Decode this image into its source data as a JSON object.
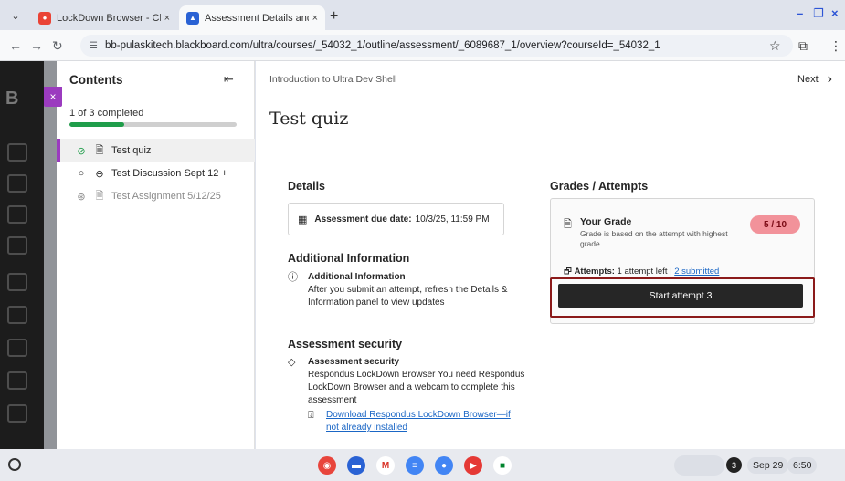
{
  "browser": {
    "tabs": [
      {
        "title": "LockDown Browser - Chrome W",
        "close": "×"
      },
      {
        "title": "Assessment Details and Inform",
        "close": "×"
      }
    ],
    "new_tab": "+",
    "url": "bb-pulaskitech.blackboard.com/ultra/courses/_54032_1/outline/assessment/_6089687_1/overview?courseId=_54032_1"
  },
  "contents_panel": {
    "title": "Contents",
    "progress_text": "1 of 3 completed",
    "progress_fraction": 0.33,
    "items": [
      {
        "label": "Test quiz"
      },
      {
        "label": "Test Discussion Sept 12 +"
      },
      {
        "label": "Test Assignment 5/12/25"
      }
    ]
  },
  "main": {
    "breadcrumb": "Introduction to Ultra Dev Shell",
    "next_label": "Next",
    "page_title": "Test quiz",
    "details": {
      "heading": "Details",
      "due_label": "Assessment due date:",
      "due_value": "10/3/25, 11:59 PM"
    },
    "additional_info": {
      "heading": "Additional Information",
      "title": "Additional Information",
      "body": "After you submit an attempt, refresh the Details & Information panel to view updates"
    },
    "security": {
      "heading": "Assessment security",
      "title": "Assessment security",
      "body": "Respondus LockDown Browser You need Respondus LockDown Browser and a webcam to complete this assessment",
      "download_link": "Download Respondus LockDown Browser—if not already installed"
    },
    "grades": {
      "heading": "Grades / Attempts",
      "your_grade_label": "Your Grade",
      "grade_note": "Grade is based on the attempt with highest grade.",
      "grade_value": "5 / 10",
      "attempts_label": "Attempts:",
      "attempts_left": "1 attempt left",
      "attempts_submitted": "2 submitted",
      "start_button": "Start attempt 3"
    }
  },
  "shelf": {
    "badge": "3",
    "date": "Sep 29",
    "time": "6:50"
  },
  "colors": {
    "accent_purple": "#9b3bbf",
    "progress_green": "#1f9d4a",
    "grade_pill": "#f2929a",
    "highlight_box": "#8b1a1a",
    "link_blue": "#1a66c5"
  }
}
